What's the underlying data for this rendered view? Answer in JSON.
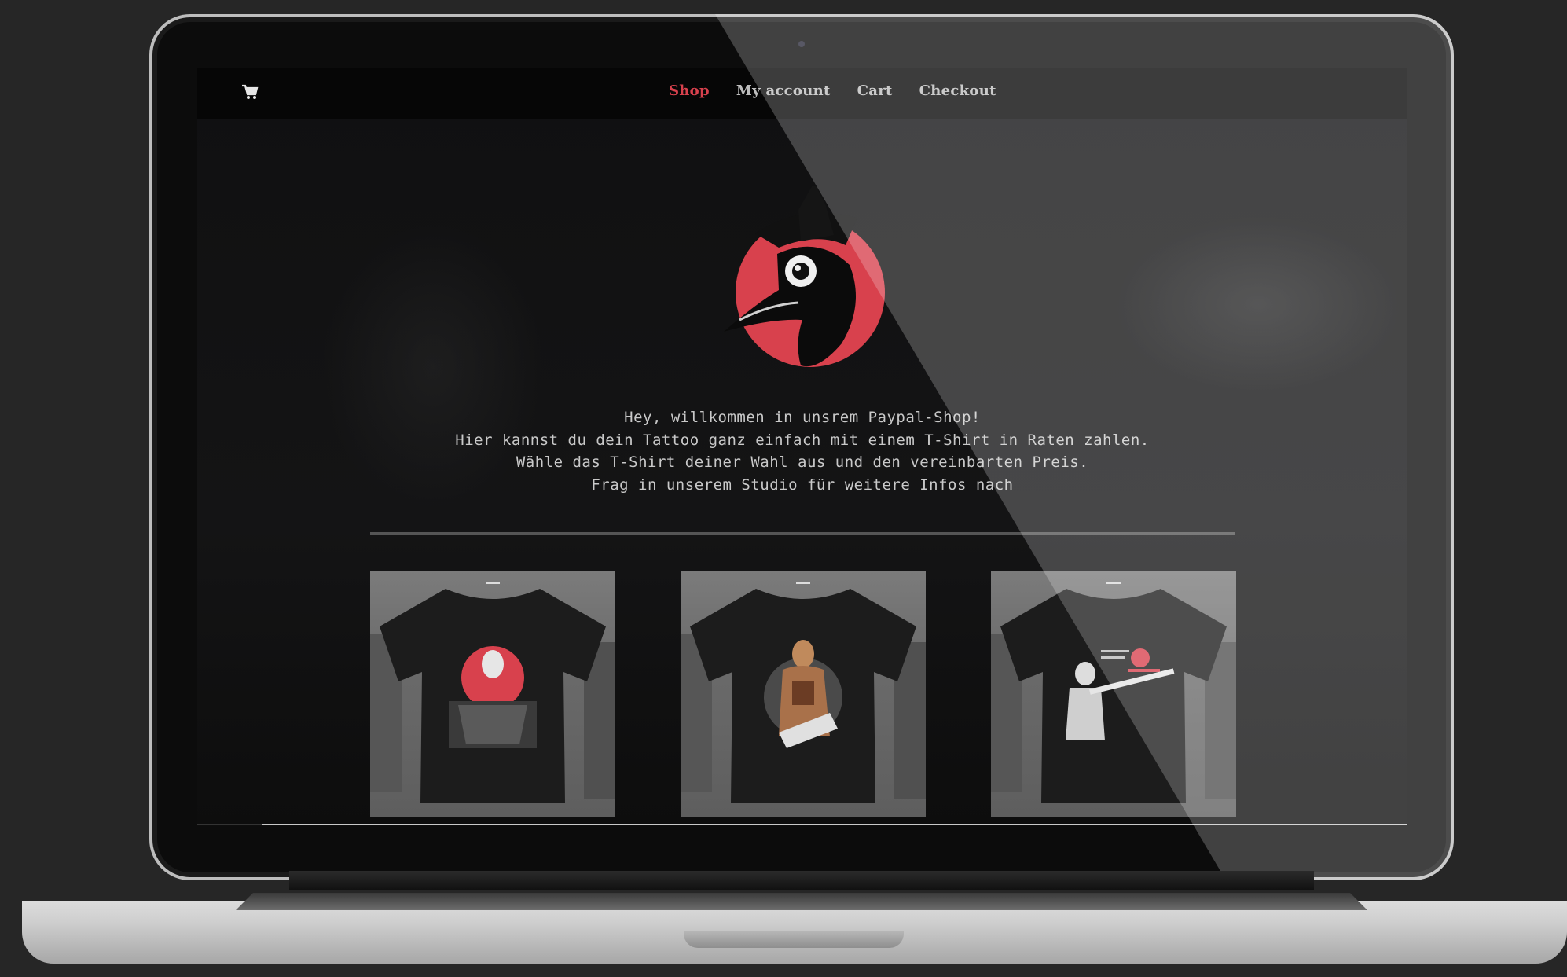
{
  "nav": {
    "cart_icon": "cart-icon",
    "items": [
      {
        "label": "Shop",
        "active": true
      },
      {
        "label": "My account",
        "active": false
      },
      {
        "label": "Cart",
        "active": false
      },
      {
        "label": "Checkout",
        "active": false
      }
    ]
  },
  "colors": {
    "accent": "#d8414d",
    "nav_text": "#bdbdbd",
    "body_text": "#c9c9c9",
    "background": "#0f0f10"
  },
  "logo": "plague-doctor-logo",
  "intro": {
    "line1": "Hey, willkommen in unsrem Paypal-Shop!",
    "line2": "Hier kannst du dein Tattoo ganz einfach mit einem T-Shirt in Raten zahlen.",
    "line3": "Wähle das T-Shirt deiner Wahl aus und den vereinbarten Preis.",
    "line4": "Frag in unserem Studio für weitere Infos nach"
  },
  "products": [
    {
      "image": "tshirt-plague-doctor-print"
    },
    {
      "image": "tshirt-tattooed-man-print"
    },
    {
      "image": "tshirt-shotgun-print"
    }
  ]
}
